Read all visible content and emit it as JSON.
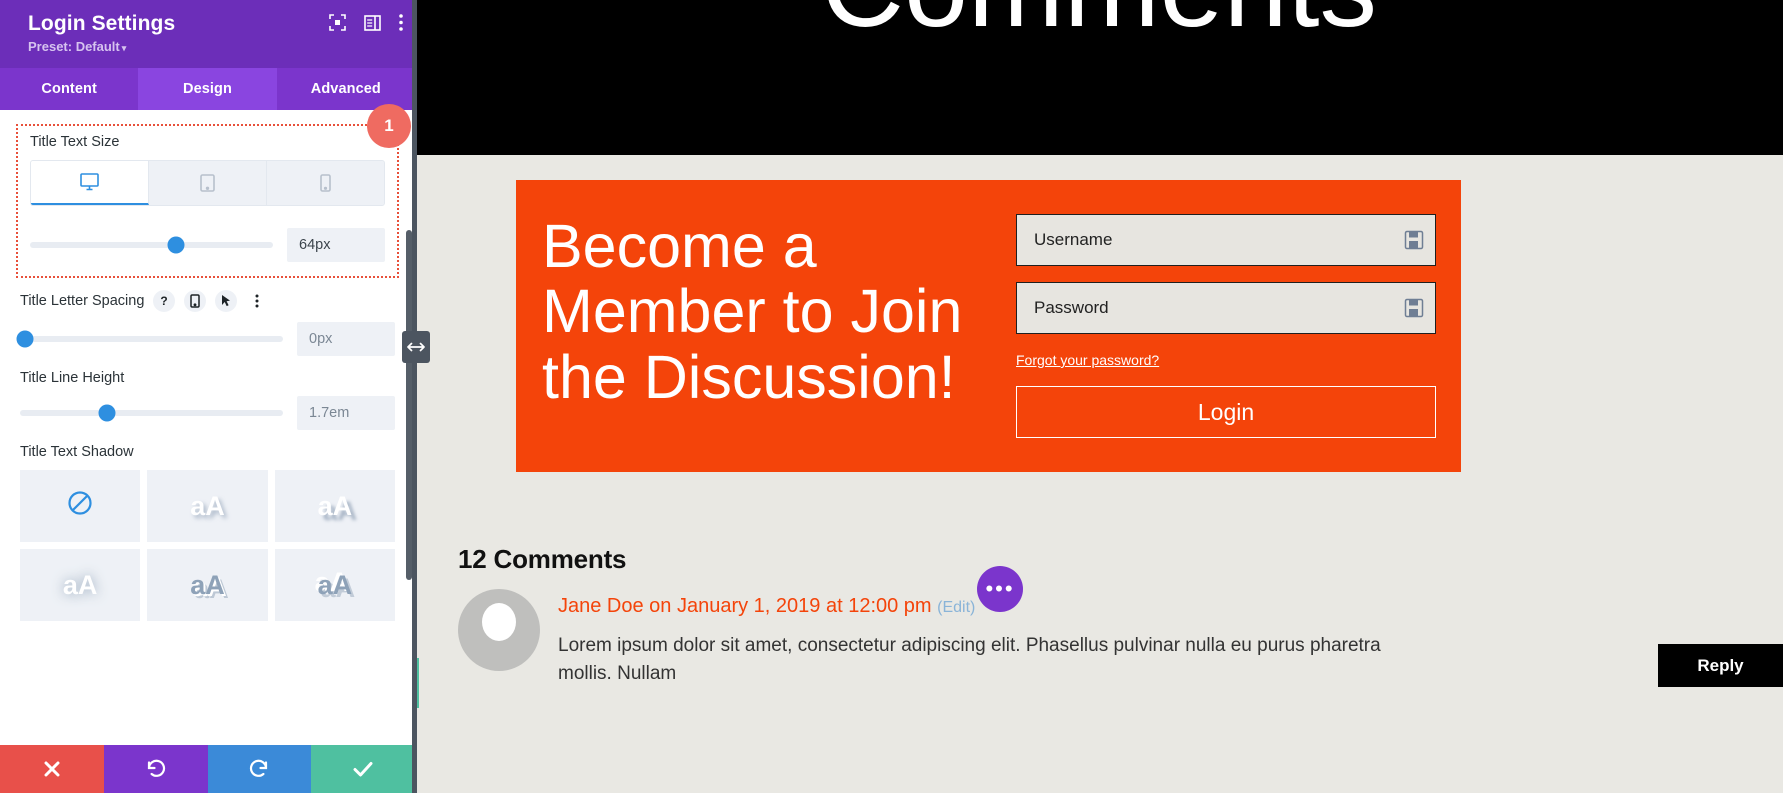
{
  "panel": {
    "title": "Login Settings",
    "preset": "Preset: Default",
    "preset_caret": "▾",
    "header_icons": [
      {
        "name": "fullscreen-icon"
      },
      {
        "name": "layout-panel-icon"
      },
      {
        "name": "kebab-menu-icon"
      }
    ],
    "tabs": [
      {
        "label": "Content",
        "active": false
      },
      {
        "label": "Design",
        "active": true
      },
      {
        "label": "Advanced",
        "active": false
      }
    ],
    "badge": "1",
    "options": {
      "title_text_size": {
        "label": "Title Text Size",
        "devices": [
          "desktop",
          "tablet",
          "phone"
        ],
        "active_device": "desktop",
        "value": "64px",
        "slider_percent": 60
      },
      "title_letter_spacing": {
        "label": "Title Letter Spacing",
        "icons": [
          "help-icon",
          "responsive-icon",
          "hover-cursor-icon",
          "kebab-menu-icon"
        ],
        "value": "0px",
        "slider_percent": 2
      },
      "title_line_height": {
        "label": "Title Line Height",
        "value": "1.7em",
        "slider_percent": 33
      },
      "title_text_shadow": {
        "label": "Title Text Shadow",
        "presets": [
          {
            "name": "none",
            "glyph": "⊘"
          },
          {
            "name": "shadow-1",
            "glyph": "aA"
          },
          {
            "name": "shadow-2",
            "glyph": "aA"
          },
          {
            "name": "shadow-3",
            "glyph": "aA"
          },
          {
            "name": "shadow-4",
            "glyph": "aA"
          },
          {
            "name": "shadow-5",
            "glyph": "aA"
          }
        ]
      }
    },
    "footer": [
      {
        "name": "cancel",
        "glyph": "✖"
      },
      {
        "name": "undo",
        "glyph": "↺"
      },
      {
        "name": "redo",
        "glyph": "↻"
      },
      {
        "name": "save",
        "glyph": "✔"
      }
    ]
  },
  "preview": {
    "hero_title": "Comments",
    "login_module": {
      "heading": "Become a Member to Join the Discussion!",
      "username_placeholder": "Username",
      "password_placeholder": "Password",
      "forgot_link": "Forgot your password?",
      "login_button": "Login",
      "accent_color": "#f4440a"
    },
    "comments": {
      "count_label": "12 Comments",
      "first": {
        "meta": "Jane Doe on January 1, 2019 at 12:00 pm",
        "edit": "(Edit)",
        "text": "Lorem ipsum dolor sit amet, consectetur adipiscing elit. Phasellus pulvinar nulla eu purus pharetra mollis. Nullam"
      },
      "reply_button": "Reply",
      "fab_glyph": "•••"
    }
  }
}
